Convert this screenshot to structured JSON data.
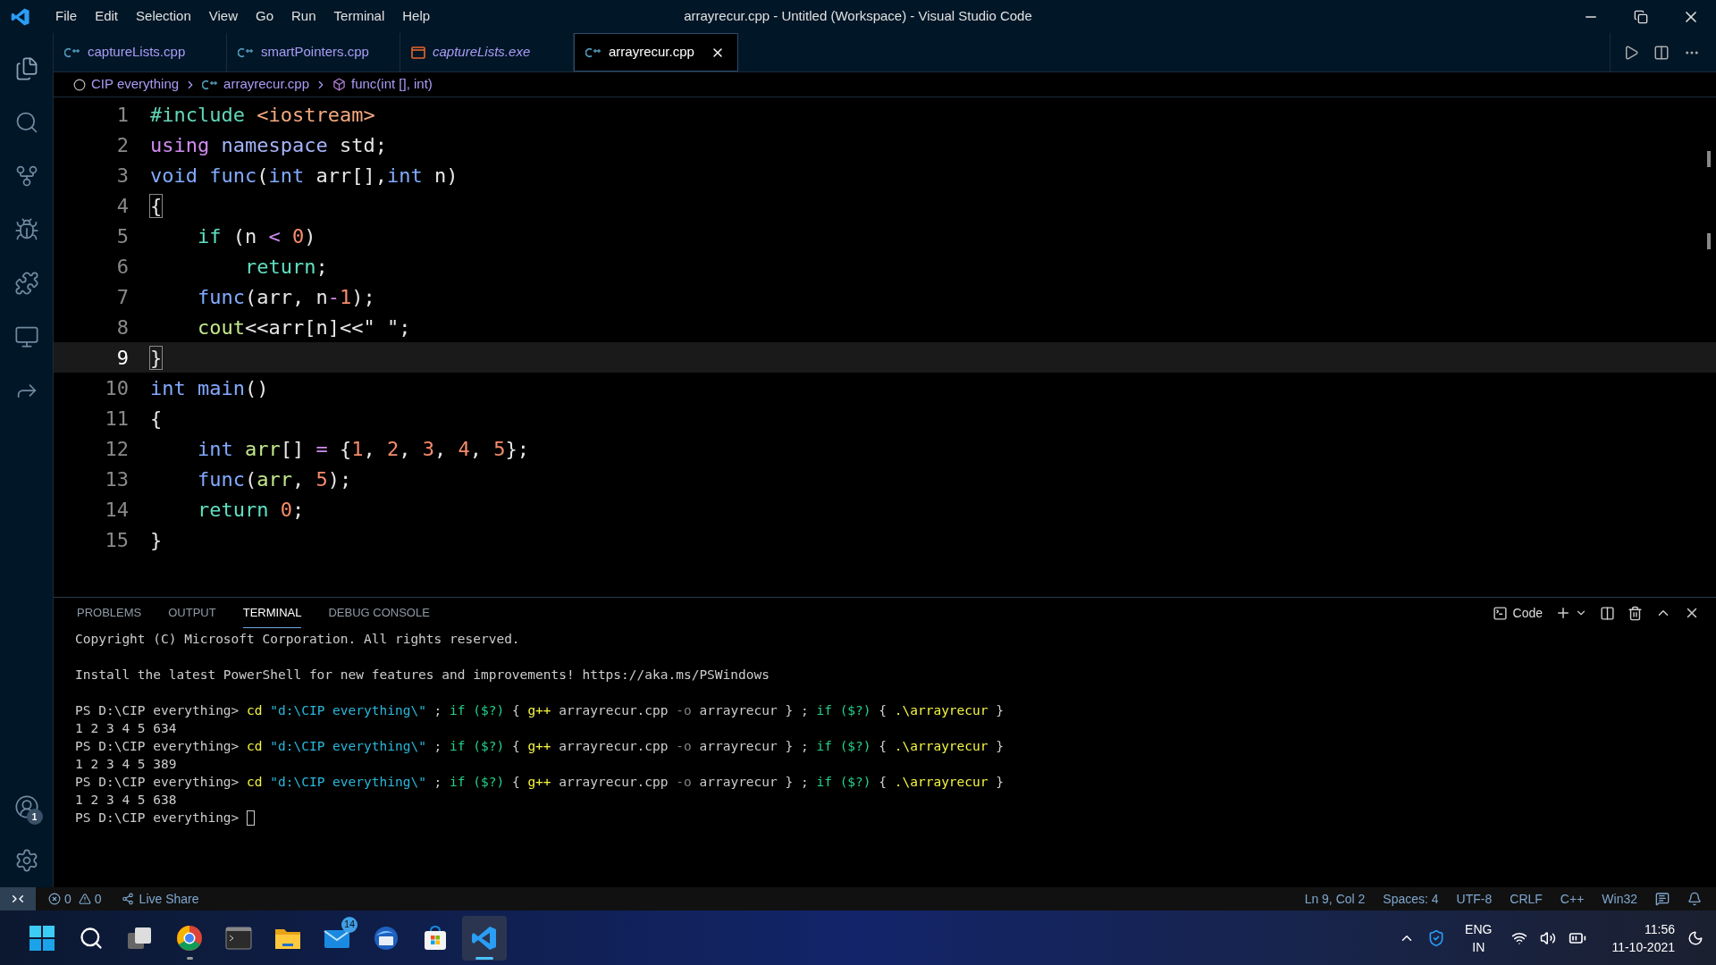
{
  "window": {
    "title": "arrayrecur.cpp - Untitled (Workspace) - Visual Studio Code"
  },
  "menu": [
    "File",
    "Edit",
    "Selection",
    "View",
    "Go",
    "Run",
    "Terminal",
    "Help"
  ],
  "tabs": [
    {
      "label": "captureLists.cpp",
      "kind": "cpp",
      "selected": false,
      "italic": false
    },
    {
      "label": "smartPointers.cpp",
      "kind": "cpp",
      "selected": false,
      "italic": false
    },
    {
      "label": "captureLists.exe",
      "kind": "exe",
      "selected": false,
      "italic": true
    },
    {
      "label": "arrayrecur.cpp",
      "kind": "cpp",
      "selected": true,
      "italic": false
    }
  ],
  "breadcrumb": [
    {
      "label": "CIP everything",
      "kind": "folder"
    },
    {
      "label": "arrayrecur.cpp",
      "kind": "cpp"
    },
    {
      "label": "func(int [], int)",
      "kind": "symbol"
    }
  ],
  "editor": {
    "lines": [
      {
        "number": "1",
        "current": false,
        "tokens": [
          {
            "kind": "include",
            "text": "#include "
          },
          {
            "kind": "string",
            "text": "<iostream>"
          }
        ]
      },
      {
        "number": "2",
        "current": false,
        "tokens": [
          {
            "kind": "using",
            "text": "using "
          },
          {
            "kind": "namespace",
            "text": "namespace"
          },
          {
            "kind": "plain",
            "text": " std;"
          }
        ]
      },
      {
        "number": "3",
        "current": false,
        "tokens": [
          {
            "kind": "type",
            "text": "void "
          },
          {
            "kind": "func",
            "text": "func"
          },
          {
            "kind": "plain",
            "text": "("
          },
          {
            "kind": "type",
            "text": "int"
          },
          {
            "kind": "plain",
            "text": " arr[],"
          },
          {
            "kind": "type",
            "text": "int"
          },
          {
            "kind": "plain",
            "text": " n)"
          }
        ]
      },
      {
        "number": "4",
        "current": false,
        "tokens": [
          {
            "kind": "brace_match",
            "text": "{"
          }
        ]
      },
      {
        "number": "5",
        "current": false,
        "tokens": [
          {
            "kind": "keyword",
            "text": "    if"
          },
          {
            "kind": "plain",
            "text": " (n "
          },
          {
            "kind": "operator",
            "text": "< "
          },
          {
            "kind": "number",
            "text": "0"
          },
          {
            "kind": "plain",
            "text": ")"
          }
        ]
      },
      {
        "number": "6",
        "current": false,
        "tokens": [
          {
            "kind": "keyword",
            "text": "        return"
          },
          {
            "kind": "plain",
            "text": ";"
          }
        ]
      },
      {
        "number": "7",
        "current": false,
        "tokens": [
          {
            "kind": "func",
            "text": "    func"
          },
          {
            "kind": "plain",
            "text": "(arr, n"
          },
          {
            "kind": "operator",
            "text": "-"
          },
          {
            "kind": "number",
            "text": "1"
          },
          {
            "kind": "plain",
            "text": ");"
          }
        ]
      },
      {
        "number": "8",
        "current": false,
        "tokens": [
          {
            "kind": "cout",
            "text": "    cout"
          },
          {
            "kind": "plain",
            "text": "<<arr[n]<<\" \";"
          }
        ]
      },
      {
        "number": "9",
        "current": true,
        "tokens": [
          {
            "kind": "brace_match",
            "text": "}"
          }
        ]
      },
      {
        "number": "10",
        "current": false,
        "tokens": [
          {
            "kind": "type",
            "text": "int "
          },
          {
            "kind": "func",
            "text": "main"
          },
          {
            "kind": "plain",
            "text": "()"
          }
        ]
      },
      {
        "number": "11",
        "current": false,
        "tokens": [
          {
            "kind": "plain",
            "text": "{"
          }
        ]
      },
      {
        "number": "12",
        "current": false,
        "tokens": [
          {
            "kind": "type",
            "text": "    int "
          },
          {
            "kind": "var",
            "text": "arr"
          },
          {
            "kind": "plain",
            "text": "[] "
          },
          {
            "kind": "operator",
            "text": "="
          },
          {
            "kind": "plain",
            "text": " {"
          },
          {
            "kind": "number",
            "text": "1"
          },
          {
            "kind": "plain",
            "text": ", "
          },
          {
            "kind": "number",
            "text": "2"
          },
          {
            "kind": "plain",
            "text": ", "
          },
          {
            "kind": "number",
            "text": "3"
          },
          {
            "kind": "plain",
            "text": ", "
          },
          {
            "kind": "number",
            "text": "4"
          },
          {
            "kind": "plain",
            "text": ", "
          },
          {
            "kind": "number",
            "text": "5"
          },
          {
            "kind": "plain",
            "text": "};"
          }
        ]
      },
      {
        "number": "13",
        "current": false,
        "tokens": [
          {
            "kind": "func",
            "text": "    func"
          },
          {
            "kind": "plain",
            "text": "("
          },
          {
            "kind": "var",
            "text": "arr"
          },
          {
            "kind": "plain",
            "text": ", "
          },
          {
            "kind": "number",
            "text": "5"
          },
          {
            "kind": "plain",
            "text": ");"
          }
        ]
      },
      {
        "number": "14",
        "current": false,
        "tokens": [
          {
            "kind": "keyword",
            "text": "    return "
          },
          {
            "kind": "number",
            "text": "0"
          },
          {
            "kind": "plain",
            "text": ";"
          }
        ]
      },
      {
        "number": "15",
        "current": false,
        "tokens": [
          {
            "kind": "plain",
            "text": "}"
          }
        ]
      }
    ]
  },
  "panel": {
    "tabs": [
      {
        "label": "PROBLEMS",
        "selected": false
      },
      {
        "label": "OUTPUT",
        "selected": false
      },
      {
        "label": "TERMINAL",
        "selected": true
      },
      {
        "label": "DEBUG CONSOLE",
        "selected": false
      }
    ],
    "terminal_profile": "Code",
    "lines": [
      {
        "spaced": false,
        "cursor": false,
        "tokens": [
          {
            "kind": "plain",
            "text": "Copyright (C) Microsoft Corporation. All rights reserved."
          }
        ]
      },
      {
        "spaced": true,
        "cursor": false,
        "tokens": [
          {
            "kind": "plain",
            "text": "Install the latest PowerShell for new features and improvements! https://aka.ms/PSWindows"
          }
        ]
      },
      {
        "spaced": true,
        "cursor": false,
        "tokens": [
          {
            "kind": "plain",
            "text": "PS D:\\CIP everything> "
          },
          {
            "kind": "command",
            "text": "cd "
          },
          {
            "kind": "string",
            "text": "\"d:\\CIP everything\\\""
          },
          {
            "kind": "plain",
            "text": " ; "
          },
          {
            "kind": "keyword",
            "text": "if ($?)"
          },
          {
            "kind": "plain",
            "text": " { "
          },
          {
            "kind": "command",
            "text": "g++"
          },
          {
            "kind": "plain",
            "text": " arrayrecur.cpp "
          },
          {
            "kind": "flag",
            "text": "-o"
          },
          {
            "kind": "plain",
            "text": " arrayrecur } ; "
          },
          {
            "kind": "keyword",
            "text": "if ($?)"
          },
          {
            "kind": "plain",
            "text": " { "
          },
          {
            "kind": "command",
            "text": ".\\arrayrecur"
          },
          {
            "kind": "plain",
            "text": " }"
          }
        ]
      },
      {
        "spaced": false,
        "cursor": false,
        "tokens": [
          {
            "kind": "plain",
            "text": "1 2 3 4 5 634"
          }
        ]
      },
      {
        "spaced": false,
        "cursor": false,
        "tokens": [
          {
            "kind": "plain",
            "text": "PS D:\\CIP everything> "
          },
          {
            "kind": "command",
            "text": "cd "
          },
          {
            "kind": "string",
            "text": "\"d:\\CIP everything\\\""
          },
          {
            "kind": "plain",
            "text": " ; "
          },
          {
            "kind": "keyword",
            "text": "if ($?)"
          },
          {
            "kind": "plain",
            "text": " { "
          },
          {
            "kind": "command",
            "text": "g++"
          },
          {
            "kind": "plain",
            "text": " arrayrecur.cpp "
          },
          {
            "kind": "flag",
            "text": "-o"
          },
          {
            "kind": "plain",
            "text": " arrayrecur } ; "
          },
          {
            "kind": "keyword",
            "text": "if ($?)"
          },
          {
            "kind": "plain",
            "text": " { "
          },
          {
            "kind": "command",
            "text": ".\\arrayrecur"
          },
          {
            "kind": "plain",
            "text": " }"
          }
        ]
      },
      {
        "spaced": false,
        "cursor": false,
        "tokens": [
          {
            "kind": "plain",
            "text": "1 2 3 4 5 389"
          }
        ]
      },
      {
        "spaced": false,
        "cursor": false,
        "tokens": [
          {
            "kind": "plain",
            "text": "PS D:\\CIP everything> "
          },
          {
            "kind": "command",
            "text": "cd "
          },
          {
            "kind": "string",
            "text": "\"d:\\CIP everything\\\""
          },
          {
            "kind": "plain",
            "text": " ; "
          },
          {
            "kind": "keyword",
            "text": "if ($?)"
          },
          {
            "kind": "plain",
            "text": " { "
          },
          {
            "kind": "command",
            "text": "g++"
          },
          {
            "kind": "plain",
            "text": " arrayrecur.cpp "
          },
          {
            "kind": "flag",
            "text": "-o"
          },
          {
            "kind": "plain",
            "text": " arrayrecur } ; "
          },
          {
            "kind": "keyword",
            "text": "if ($?)"
          },
          {
            "kind": "plain",
            "text": " { "
          },
          {
            "kind": "command",
            "text": ".\\arrayrecur"
          },
          {
            "kind": "plain",
            "text": " }"
          }
        ]
      },
      {
        "spaced": false,
        "cursor": false,
        "tokens": [
          {
            "kind": "plain",
            "text": "1 2 3 4 5 638"
          }
        ]
      },
      {
        "spaced": false,
        "cursor": true,
        "tokens": [
          {
            "kind": "plain",
            "text": "PS D:\\CIP everything> "
          }
        ]
      }
    ]
  },
  "activity_bar": {
    "accounts_badge": "1"
  },
  "status_bar": {
    "errors": "0",
    "warnings": "0",
    "live_share": "Live Share",
    "right": [
      "Ln 9, Col 2",
      "Spaces: 4",
      "UTF-8",
      "CRLF",
      "C++",
      "Win32"
    ]
  },
  "taskbar": {
    "apps": [
      {
        "kind": "start",
        "running": false,
        "selected": false
      },
      {
        "kind": "search",
        "running": false,
        "selected": false
      },
      {
        "kind": "taskview",
        "running": false,
        "selected": false
      },
      {
        "kind": "browser",
        "running": true,
        "selected": false
      },
      {
        "kind": "terminal",
        "running": false,
        "selected": false
      },
      {
        "kind": "folder",
        "running": false,
        "selected": false
      },
      {
        "kind": "mail",
        "running": false,
        "selected": false,
        "badge": "14"
      },
      {
        "kind": "mailclient",
        "running": false,
        "selected": false
      },
      {
        "kind": "store",
        "running": false,
        "selected": false
      },
      {
        "kind": "vscode",
        "running": true,
        "selected": true
      }
    ],
    "language": "ENG",
    "region": "IN",
    "time": "11:56",
    "date": "11-10-2021"
  }
}
